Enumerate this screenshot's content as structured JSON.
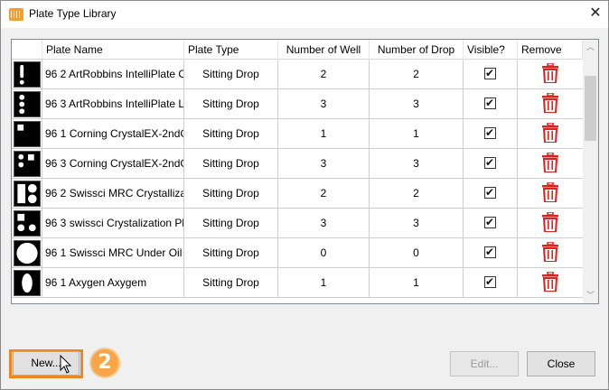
{
  "window": {
    "title": "Plate Type Library"
  },
  "grid": {
    "columns": [
      "Plate Name",
      "Plate Type",
      "Number of Well",
      "Number of Drop",
      "Visible?",
      "Remove"
    ],
    "rows": [
      {
        "name": "96 2 ArtRobbins IntelliPlate C",
        "type": "Sitting Drop",
        "wells": "2",
        "drops": "2",
        "visible": true
      },
      {
        "name": "96 3 ArtRobbins IntelliPlate L",
        "type": "Sitting Drop",
        "wells": "3",
        "drops": "3",
        "visible": true
      },
      {
        "name": "96 1 Corning CrystalEX-2ndG",
        "type": "Sitting Drop",
        "wells": "1",
        "drops": "1",
        "visible": true
      },
      {
        "name": "96 3 Corning CrystalEX-2ndG",
        "type": "Sitting Drop",
        "wells": "3",
        "drops": "3",
        "visible": true
      },
      {
        "name": "96 2 Swissci MRC Crystallizat",
        "type": "Sitting Drop",
        "wells": "2",
        "drops": "2",
        "visible": true
      },
      {
        "name": "96 3 swissci Crystalization Pla",
        "type": "Sitting Drop",
        "wells": "3",
        "drops": "3",
        "visible": true
      },
      {
        "name": "96 1 Swissci MRC Under Oil",
        "type": "Sitting Drop",
        "wells": "0",
        "drops": "0",
        "visible": true
      },
      {
        "name": "96 1 Axygen Axygem",
        "type": "Sitting Drop",
        "wells": "1",
        "drops": "1",
        "visible": true
      }
    ]
  },
  "buttons": {
    "new_label": "New...",
    "edit_label": "Edit...",
    "close_label": "Close"
  },
  "annotation": {
    "step_number": "2"
  },
  "colors": {
    "accent_orange": "#f0851e",
    "trash_red": "#e0201c",
    "badge_orange": "#f7a548"
  },
  "icons": {
    "remove": "trash-icon",
    "close": "close-icon",
    "visible": "checkbox-checked-icon"
  }
}
